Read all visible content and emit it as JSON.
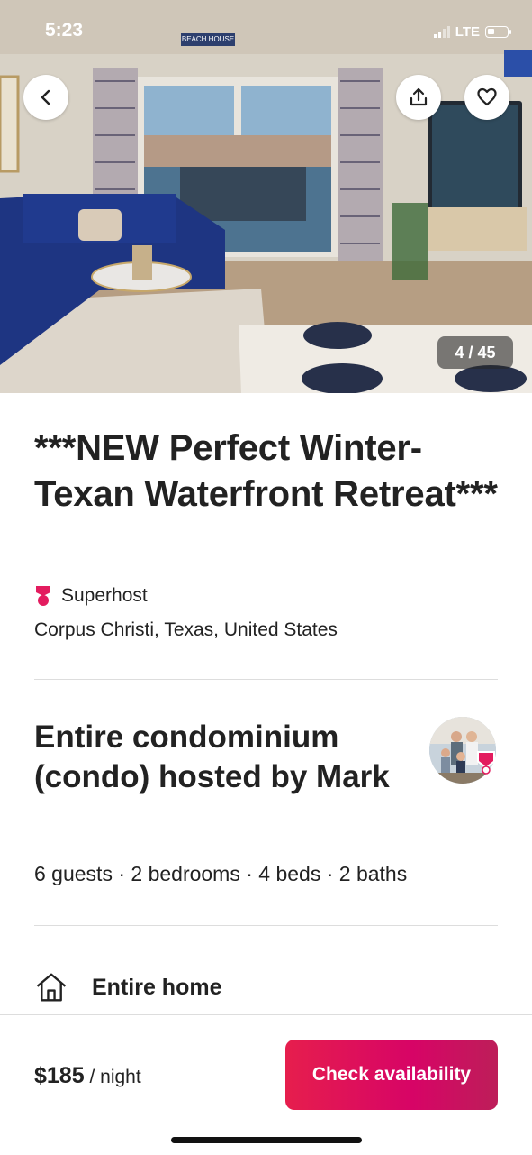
{
  "status_bar": {
    "time": "5:23",
    "network": "LTE"
  },
  "photo": {
    "sign_text": "BEACH HOUSE",
    "counter": "4 / 45",
    "icons": {
      "back": "chevron-left-icon",
      "share": "share-icon",
      "save": "heart-icon"
    }
  },
  "listing": {
    "title": "***NEW Perfect Winter-Texan Waterfront Retreat***",
    "superhost_label": "Superhost",
    "location": "Corpus Christi, Texas, United States",
    "hosted_title": "Entire condominium (condo) hosted by Mark",
    "stats": "6 guests · 2 bedrooms · 4 beds · 2 baths",
    "feature_label": "Entire home"
  },
  "footer": {
    "price": "$185",
    "price_unit": "/ night",
    "cta_label": "Check availability"
  },
  "colors": {
    "brand": "#E61E4D",
    "superhost_badge": "#E31C5F",
    "text": "#222222",
    "divider": "#DDDDDD"
  }
}
